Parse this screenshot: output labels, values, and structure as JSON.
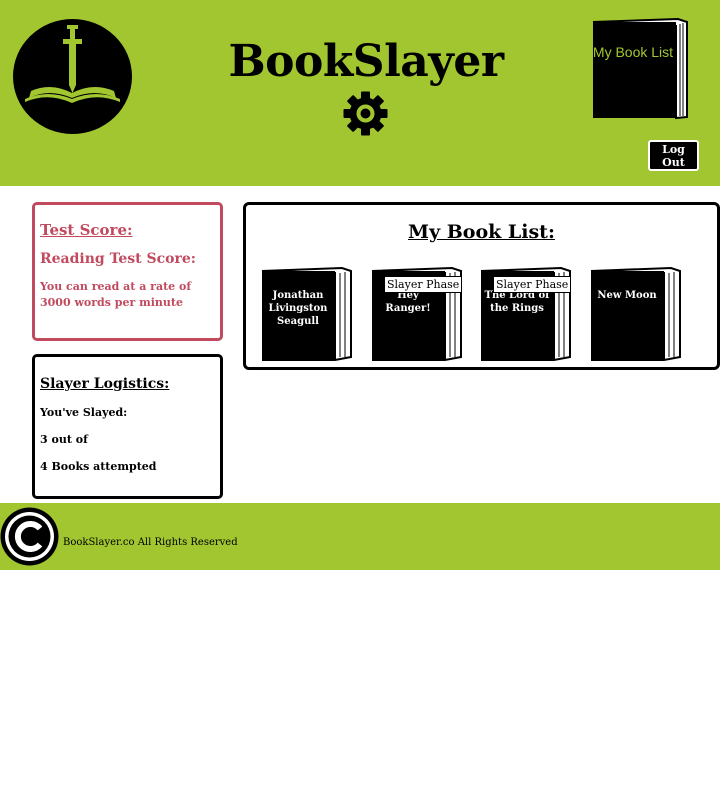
{
  "header": {
    "site_title": "BookSlayer",
    "my_book_list_button": "My Book List",
    "logout_label": "Log Out",
    "accent_color": "#a2c630"
  },
  "score_panel": {
    "title": "Test Score:",
    "reading_title": "Reading Test Score:",
    "rate_text": "You can read at a rate of 3000 words per minute",
    "accent_color": "#c14a5e"
  },
  "logistics": {
    "title": "Slayer Logistics:",
    "slayed_label": "You've Slayed:",
    "slayed_count": "3 out of",
    "attempted": "4 Books attempted"
  },
  "booklist": {
    "title": "My Book List:",
    "books": [
      {
        "title": "Jonathan Livingston Seagull",
        "phase": ""
      },
      {
        "title": "Hey Ranger!",
        "phase": "Slayer Phase"
      },
      {
        "title": "The Lord of the Rings",
        "phase": "Slayer Phase"
      },
      {
        "title": "New Moon",
        "phase": ""
      }
    ]
  },
  "footer": {
    "text": "BookSlayer.co All Rights Reserved"
  },
  "icons": {
    "logo": "sword-in-book-icon",
    "settings": "gear-icon",
    "copyright": "copyright-icon"
  }
}
